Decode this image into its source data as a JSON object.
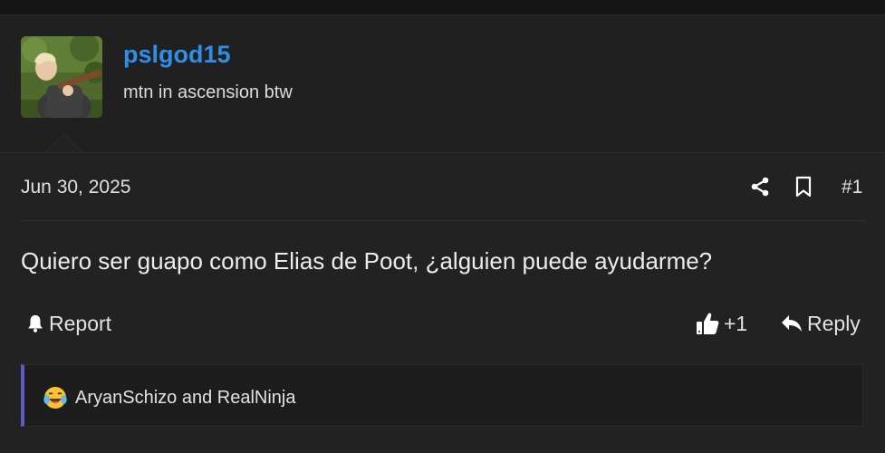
{
  "post": {
    "author": {
      "username": "pslgod15",
      "user_title": "mtn in ascension btw"
    },
    "date": "Jun 30, 2025",
    "post_number": "#1",
    "message": "Quiero ser guapo como Elias de Poot, ¿alguien puede ayudarme?",
    "actions": {
      "report_label": "Report",
      "like_count": "+1",
      "reply_label": "Reply"
    },
    "reactions": {
      "emoji_icon": "crying-laughing-face",
      "users_text": "AryanSchizo and RealNinja"
    }
  },
  "colors": {
    "username": "#2f8fe6",
    "reaction_accent": "#5a5fbf",
    "background": "#222222"
  }
}
